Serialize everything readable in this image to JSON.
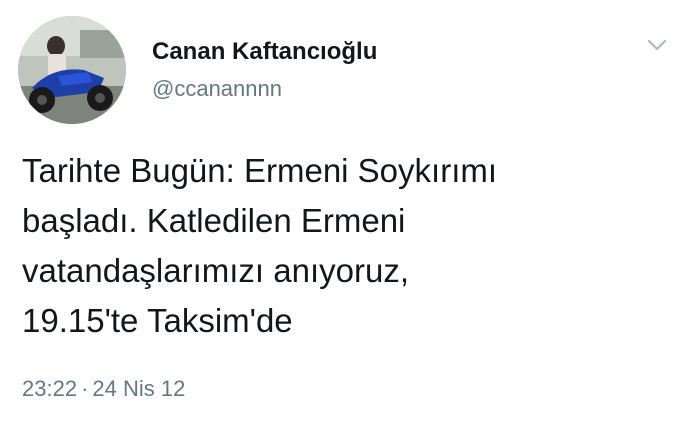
{
  "author": {
    "display_name": "Canan Kaftancıoğlu",
    "handle": "@ccanannnn",
    "avatar_icon": "profile-photo-motorcycle"
  },
  "tweet": {
    "lines": [
      "Tarihte Bugün: Ermeni Soykırımı",
      "başladı. Katledilen Ermeni",
      "vatandaşlarımızı anıyoruz,",
      "19.15'te Taksim'de"
    ],
    "time": "23:22",
    "separator": "·",
    "date": "24 Nis 12"
  },
  "menu": {
    "icon": "chevron-down-icon"
  },
  "colors": {
    "text_primary": "#14171a",
    "text_secondary": "#657786",
    "chevron": "#aab8c2",
    "background": "#ffffff"
  }
}
